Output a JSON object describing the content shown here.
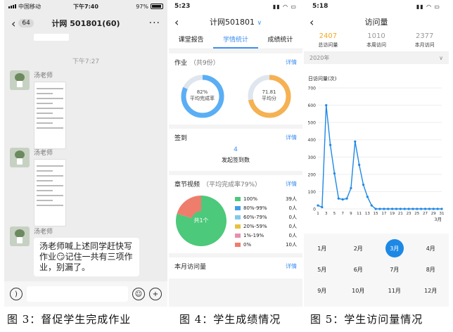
{
  "panel1": {
    "status": {
      "carrier": "中国移动",
      "time": "下午7:40",
      "battery": "97%"
    },
    "nav": {
      "back_count": "64",
      "title": "计网 501801(60)",
      "more": "···"
    },
    "time_divider": "下午7:27",
    "messages": [
      {
        "sender": "汤老师",
        "type": "image"
      },
      {
        "sender": "汤老师",
        "type": "image"
      },
      {
        "sender": "汤老师",
        "type": "text",
        "text": "汤老师喊上述同学赶快写作业😏记住一共有三项作业，别漏了。"
      }
    ]
  },
  "panel2": {
    "status": {
      "time": "5:23"
    },
    "header": {
      "title": "计网501801",
      "arrow": "∨"
    },
    "tabs": [
      "课堂报告",
      "学情统计",
      "成绩统计"
    ],
    "active_tab": 1,
    "homework": {
      "title": "作业",
      "sub": "（共9份）",
      "link": "详情",
      "completion": {
        "value": "82%",
        "label": "平均完成率",
        "percent": 82
      },
      "score": {
        "value": "71.81",
        "label": "平均分",
        "percent": 72
      }
    },
    "checkin": {
      "title": "签到",
      "link": "详情",
      "count": "4",
      "label": "发起签到数"
    },
    "chapter": {
      "title": "章节视频",
      "sub": "（平均完成率79%）",
      "link": "详情",
      "center": "共1个",
      "legend": [
        {
          "label": "100%",
          "count": "39人",
          "color": "#4cc97a",
          "value": 39
        },
        {
          "label": "80%-99%",
          "count": "0人",
          "color": "#3f9ee8",
          "value": 0
        },
        {
          "label": "60%-79%",
          "count": "0人",
          "color": "#7fcbe8",
          "value": 0
        },
        {
          "label": "20%-59%",
          "count": "0人",
          "color": "#e8c23f",
          "value": 0
        },
        {
          "label": "1%-19%",
          "count": "0人",
          "color": "#e88fb0",
          "value": 0
        },
        {
          "label": "0%",
          "count": "10人",
          "color": "#ef7d6c",
          "value": 10
        }
      ]
    },
    "monthly": {
      "title": "本月访问量",
      "link": "详情"
    }
  },
  "panel3": {
    "status": {
      "time": "5:18"
    },
    "header": {
      "title": "访问量"
    },
    "stats": [
      {
        "value": "2407",
        "label": "总访问量"
      },
      {
        "value": "1010",
        "label": "本周访问"
      },
      {
        "value": "2377",
        "label": "本月访问"
      }
    ],
    "year": "2020年",
    "chart_title": "日访问量(次)",
    "month_label": "3月",
    "months": [
      "1月",
      "2月",
      "3月",
      "4月",
      "5月",
      "6月",
      "7月",
      "8月",
      "9月",
      "10月",
      "11月",
      "12月"
    ],
    "selected_month": 2
  },
  "chart_data": {
    "type": "line",
    "title": "日访问量(次)",
    "xlabel": "3月",
    "ylabel": "",
    "ylim": [
      0,
      700
    ],
    "yticks": [
      0,
      100,
      200,
      300,
      400,
      500,
      600,
      700
    ],
    "xticks": [
      1,
      3,
      5,
      7,
      9,
      11,
      13,
      15,
      17,
      19,
      21,
      23,
      25,
      27,
      29,
      31
    ],
    "x": [
      1,
      2,
      3,
      4,
      5,
      6,
      7,
      8,
      9,
      10,
      11,
      12,
      13,
      14,
      15,
      16,
      17,
      18,
      19,
      20,
      21,
      22,
      23,
      24,
      25,
      26,
      27,
      28,
      29,
      30,
      31
    ],
    "y": [
      20,
      10,
      600,
      370,
      205,
      60,
      55,
      60,
      120,
      390,
      255,
      140,
      70,
      20,
      0,
      0,
      0,
      0,
      0,
      0,
      0,
      0,
      0,
      0,
      0,
      0,
      0,
      0,
      0,
      0,
      0
    ],
    "color": "#1e88e5"
  },
  "captions": [
    "图 3：督促学生完成作业",
    "图 4：学生成绩情况",
    "图 5：学生访问量情况"
  ]
}
